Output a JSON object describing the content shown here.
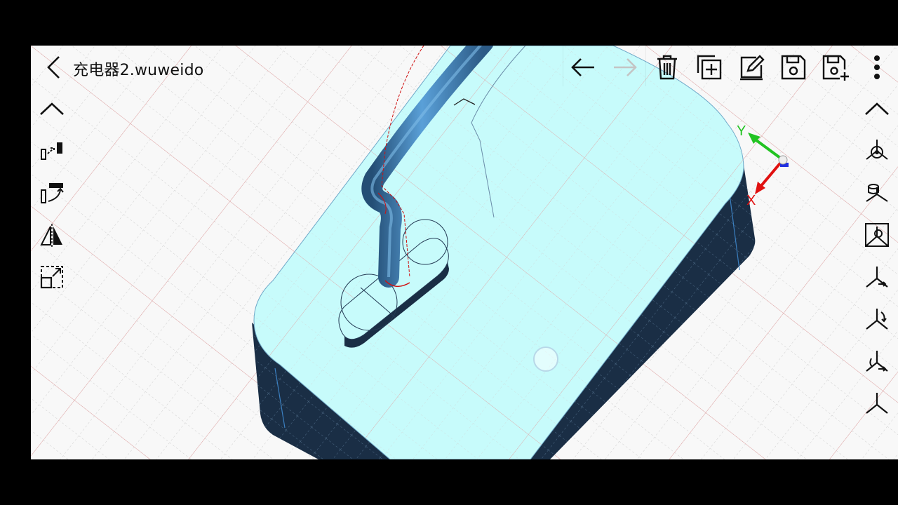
{
  "header": {
    "back_icon": "chevron-left-icon",
    "title": "充电器2.wuweido"
  },
  "toolbar": {
    "undo_icon": "arrow-left-icon",
    "redo_icon": "arrow-right-icon",
    "redo_enabled": false,
    "delete_icon": "trash-icon",
    "copy_icon": "copy-add-icon",
    "edit_icon": "edit-icon",
    "save_icon": "save-icon",
    "save_as_icon": "save-as-icon",
    "more_icon": "more-vertical-icon"
  },
  "left_panel": {
    "collapse_icon": "chevron-up-icon",
    "tools": [
      "move-icon",
      "rotate-icon",
      "mirror-icon",
      "scale-icon"
    ]
  },
  "right_panel": {
    "collapse_icon": "chevron-up-icon",
    "views": [
      "view-iso-icon",
      "view-top-icon",
      "view-front-icon",
      "view-axis-1-icon",
      "view-axis-2-icon",
      "view-axis-3-icon",
      "view-axis-4-icon"
    ]
  },
  "gizmo": {
    "y_label": "Y",
    "x_label": "X",
    "y_color": "#22c322",
    "x_color": "#e01010",
    "z_color": "#2030e0"
  },
  "colors": {
    "model_top": "#c7fbfb",
    "model_side": "#1a2e45",
    "cable": "#3f7fb8",
    "grid_minor": "#cfcfcf",
    "grid_major": "#e8a0a0"
  }
}
